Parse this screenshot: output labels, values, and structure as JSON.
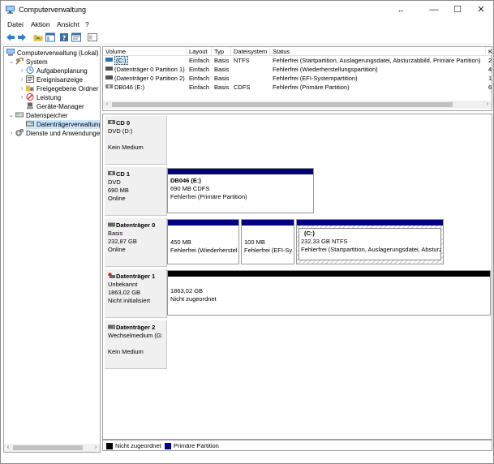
{
  "window": {
    "title": "Computerverwaltung",
    "controls": {
      "restore": "↔",
      "minimize": "—",
      "maximize": "☐",
      "close": "✕"
    }
  },
  "menu": [
    "Datei",
    "Aktion",
    "Ansicht",
    "?"
  ],
  "tree": {
    "root": "Computerverwaltung (Lokal)",
    "system": "System",
    "system_items": [
      "Aufgabenplanung",
      "Ereignisanzeige",
      "Freigegebene Ordner",
      "Leistung",
      "Geräte-Manager"
    ],
    "storage": "Datenspeicher",
    "storage_items": [
      "Datenträgerverwaltung"
    ],
    "services": "Dienste und Anwendungen"
  },
  "volumes": {
    "columns": [
      "Volume",
      "Layout",
      "Typ",
      "Dateisystem",
      "Status",
      "K"
    ],
    "rows": [
      {
        "volume": "(C:)",
        "layout": "Einfach",
        "type": "Basis",
        "fs": "NTFS",
        "status": "Fehlerfrei (Startpartition, Auslagerungsdatei, Absturzabbild, Primäre Partition)",
        "k": "2"
      },
      {
        "volume": "(Datenträger 0 Partition 1)",
        "layout": "Einfach",
        "type": "Basis",
        "fs": "",
        "status": "Fehlerfrei (Wiederherstellungspartition)",
        "k": "4"
      },
      {
        "volume": "(Datenträger 0 Partition 2)",
        "layout": "Einfach",
        "type": "Basis",
        "fs": "",
        "status": "Fehlerfrei (EFI-Systempartition)",
        "k": "1"
      },
      {
        "volume": "DB046 (E:)",
        "layout": "Einfach",
        "type": "Basis",
        "fs": "CDFS",
        "status": "Fehlerfrei (Primäre Partition)",
        "k": "6"
      }
    ]
  },
  "disks": [
    {
      "name": "CD 0",
      "line1": "DVD (D:)",
      "line2": "",
      "line3": "Kein Medium",
      "partitions": []
    },
    {
      "name": "CD 1",
      "line1": "DVD",
      "line2": "690 MB",
      "line3": "Online",
      "partitions": [
        {
          "title": "DB046  (E:)",
          "l2": "690 MB CDFS",
          "l3": "Fehlerfrei (Primäre Partition)"
        }
      ]
    },
    {
      "name": "Datenträger 0",
      "line1": "Basis",
      "line2": "232,87 GB",
      "line3": "Online",
      "partitions": [
        {
          "title": "",
          "l2": "450 MB",
          "l3": "Fehlerfrei (Wiederherstel"
        },
        {
          "title": "",
          "l2": "100 MB",
          "l3": "Fehlerfrei (EFI-Sys"
        },
        {
          "title": "(C:)",
          "l2": "232,33 GB NTFS",
          "l3": "Fehlerfrei (Startpartition, Auslagerungsdatei, Absturz"
        }
      ]
    },
    {
      "name": "Datenträger 1",
      "line1": "Unbekannt",
      "line2": "1863,02 GB",
      "line3": "Nicht initialisiert",
      "partitions": [
        {
          "title": "",
          "l2": "1863,02 GB",
          "l3": "Nicht zugeordnet"
        }
      ]
    },
    {
      "name": "Datenträger 2",
      "line1": "Wechselmedium (G:",
      "line2": "",
      "line3": "Kein Medium",
      "partitions": []
    }
  ],
  "legend": {
    "unallocated": "Nicht zugeordnet",
    "primary": "Primäre Partition"
  },
  "colors": {
    "primary": "#00007f",
    "unallocated": "#000000",
    "selection": "#cce8ff"
  }
}
